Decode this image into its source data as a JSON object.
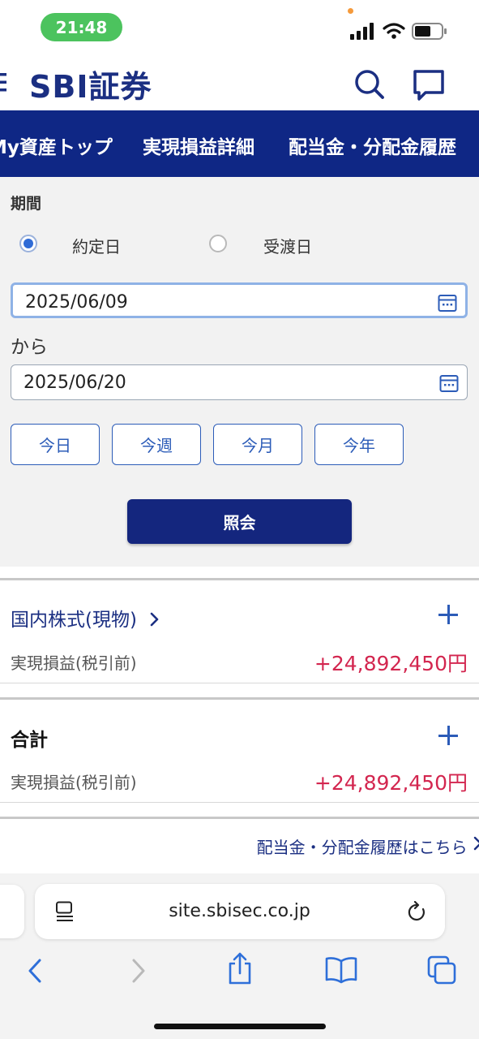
{
  "status_bar": {
    "time": "21:48"
  },
  "header": {
    "logo": "SBI証券"
  },
  "nav": {
    "tabs": [
      "My資産トップ",
      "実現損益詳細",
      "配当金・分配金履歴"
    ]
  },
  "form": {
    "period_label": "期間",
    "radios": [
      {
        "label": "約定日",
        "checked": true
      },
      {
        "label": "受渡日",
        "checked": false
      }
    ],
    "from_date": "2025/06/09",
    "connector": "から",
    "to_date": "2025/06/20",
    "quick_buttons": [
      "今日",
      "今週",
      "今月",
      "今年"
    ],
    "submit_label": "照会"
  },
  "results": {
    "domestic": {
      "title": "国内株式(現物)",
      "label": "実現損益(税引前)",
      "value": "+24,892,450円"
    },
    "total": {
      "title": "合計",
      "label": "実現損益(税引前)",
      "value": "+24,892,450円"
    },
    "dividend_link": "配当金・分配金履歴はこちら"
  },
  "browser": {
    "url": "site.sbisec.co.jp"
  },
  "colors": {
    "brand_navy": "#0f2785",
    "accent_blue": "#2c5cb8",
    "profit_red": "#d3264f"
  }
}
